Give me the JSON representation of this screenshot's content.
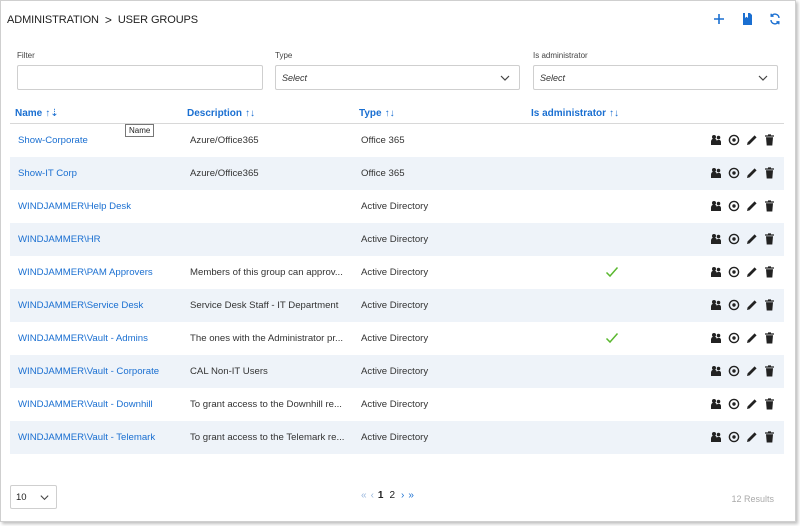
{
  "breadcrumb": {
    "section": "ADMINISTRATION",
    "separator": ">",
    "page": "USER GROUPS"
  },
  "filters": {
    "filter_label": "Filter",
    "filter_value": "",
    "type_label": "Type",
    "type_value": "Select",
    "admin_label": "Is administrator",
    "admin_value": "Select"
  },
  "columns": {
    "name": "Name",
    "description": "Description",
    "type": "Type",
    "is_admin": "Is administrator"
  },
  "tooltip": "Name",
  "rows": [
    {
      "name": "Show-Corporate",
      "description": "Azure/Office365",
      "type": "Office 365",
      "is_admin": false
    },
    {
      "name": "Show-IT Corp",
      "description": "Azure/Office365",
      "type": "Office 365",
      "is_admin": false
    },
    {
      "name": "WINDJAMMER\\Help Desk",
      "description": "",
      "type": "Active Directory",
      "is_admin": false
    },
    {
      "name": "WINDJAMMER\\HR",
      "description": "",
      "type": "Active Directory",
      "is_admin": false
    },
    {
      "name": "WINDJAMMER\\PAM Approvers",
      "description": "Members of this group can approv...",
      "type": "Active Directory",
      "is_admin": true
    },
    {
      "name": "WINDJAMMER\\Service Desk",
      "description": "Service Desk Staff - IT Department",
      "type": "Active Directory",
      "is_admin": false
    },
    {
      "name": "WINDJAMMER\\Vault - Admins",
      "description": "The ones with the Administrator pr...",
      "type": "Active Directory",
      "is_admin": true
    },
    {
      "name": "WINDJAMMER\\Vault - Corporate",
      "description": "CAL Non-IT Users",
      "type": "Active Directory",
      "is_admin": false
    },
    {
      "name": "WINDJAMMER\\Vault - Downhill",
      "description": "To grant access to the Downhill re...",
      "type": "Active Directory",
      "is_admin": false
    },
    {
      "name": "WINDJAMMER\\Vault - Telemark",
      "description": "To grant access to the Telemark re...",
      "type": "Active Directory",
      "is_admin": false
    }
  ],
  "pagination": {
    "page_size": "10",
    "first": "«",
    "prev": "‹",
    "pages": [
      "1",
      "2"
    ],
    "current": "1",
    "next": "›",
    "last": "»",
    "results": "12 Results"
  },
  "colors": {
    "accent": "#1a6fd1",
    "check": "#5ab82f",
    "row_alt": "#eef3f9"
  }
}
